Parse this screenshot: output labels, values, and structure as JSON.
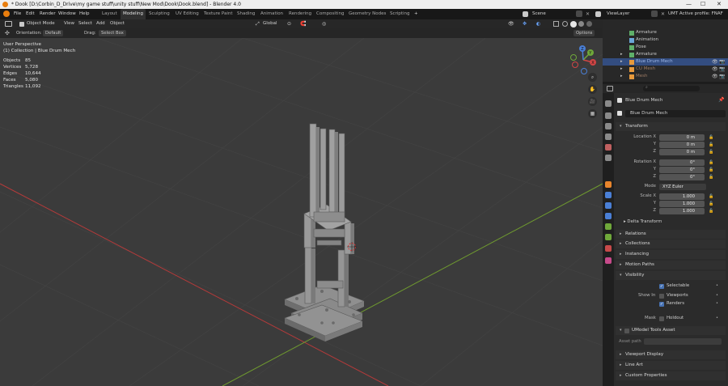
{
  "window": {
    "title": "* Dook [D:\\Corbin_D_Drive\\my game stuff\\unity stuff\\New Mod\\Dook\\Dook.blend] - Blender 4.0",
    "minimize": "—",
    "maximize": "☐",
    "close": "✕"
  },
  "menu": {
    "items": [
      "File",
      "Edit",
      "Render",
      "Window",
      "Help"
    ],
    "workspaces": [
      "Layout",
      "Modeling",
      "Sculpting",
      "UV Editing",
      "Texture Paint",
      "Shading",
      "Animation",
      "Rendering",
      "Compositing",
      "Geometry Nodes",
      "Scripting"
    ],
    "active_workspace": "Modeling",
    "add_tab": "+",
    "scene": "Scene",
    "view_layer": "ViewLayer",
    "profile": "UMT Active profile: FNAF Sb"
  },
  "header": {
    "mode": "Object Mode",
    "items": [
      "View",
      "Select",
      "Add",
      "Object"
    ],
    "transform": "Global",
    "options": "Options"
  },
  "tool_settings": {
    "orientation_label": "Orientation:",
    "orientation_value": "Default",
    "drag_label": "Drag:",
    "drag_value": "Select Box"
  },
  "viewport": {
    "perspective": "User Perspective",
    "collection_info": "(1) Collection | Blue Drum Mech",
    "stats": [
      {
        "k": "Objects",
        "v": "85"
      },
      {
        "k": "Vertices",
        "v": "5,728"
      },
      {
        "k": "Edges",
        "v": "10,644"
      },
      {
        "k": "Faces",
        "v": "5,080"
      },
      {
        "k": "Triangles",
        "v": "11,092"
      }
    ],
    "gizmo": {
      "x": "X",
      "y": "Y",
      "z": "Z"
    }
  },
  "outliner": {
    "rows": [
      {
        "label": "Armature",
        "color": "#5fb06a",
        "sel": false
      },
      {
        "label": "Animation",
        "color": "#6aa6d8",
        "sel": false
      },
      {
        "label": "Pose",
        "color": "#5fb06a",
        "sel": false
      },
      {
        "label": "Armature",
        "color": "#5fb06a",
        "sel": false
      },
      {
        "label": "Blue Drum Mech",
        "color": "#e89a3c",
        "sel": true
      },
      {
        "label": "CU Mesh",
        "color": "#e89a3c",
        "sel": false
      },
      {
        "label": "Mesh",
        "color": "#e89a3c",
        "sel": false
      }
    ]
  },
  "properties": {
    "object_name": "Blue Drum Mech",
    "data_name": "Blue Drum Mech",
    "transform": {
      "title": "Transform",
      "location_label": "Location X",
      "loc": [
        "0 m",
        "0 m",
        "0 m"
      ],
      "rotation_label": "Rotation X",
      "rot": [
        "0°",
        "0°",
        "0°"
      ],
      "mode_label": "Mode",
      "mode": "XYZ Euler",
      "scale_label": "Scale X",
      "scale": [
        "1.000",
        "1.000",
        "1.000"
      ],
      "y": "Y",
      "z": "Z",
      "delta": "Delta Transform"
    },
    "panels": {
      "relations": "Relations",
      "collections": "Collections",
      "instancing": "Instancing",
      "motion_paths": "Motion Paths",
      "visibility": "Visibility",
      "umodel": "UModel Tools Asset",
      "asset_path": "Asset path",
      "viewport_display": "Viewport Display",
      "line_art": "Line Art",
      "custom_props": "Custom Properties"
    },
    "visibility": {
      "selectable": "Selectable",
      "show_in": "Show In",
      "viewports": "Viewports",
      "renders": "Renders",
      "mask": "Mask",
      "holdout": "Holdout"
    }
  }
}
